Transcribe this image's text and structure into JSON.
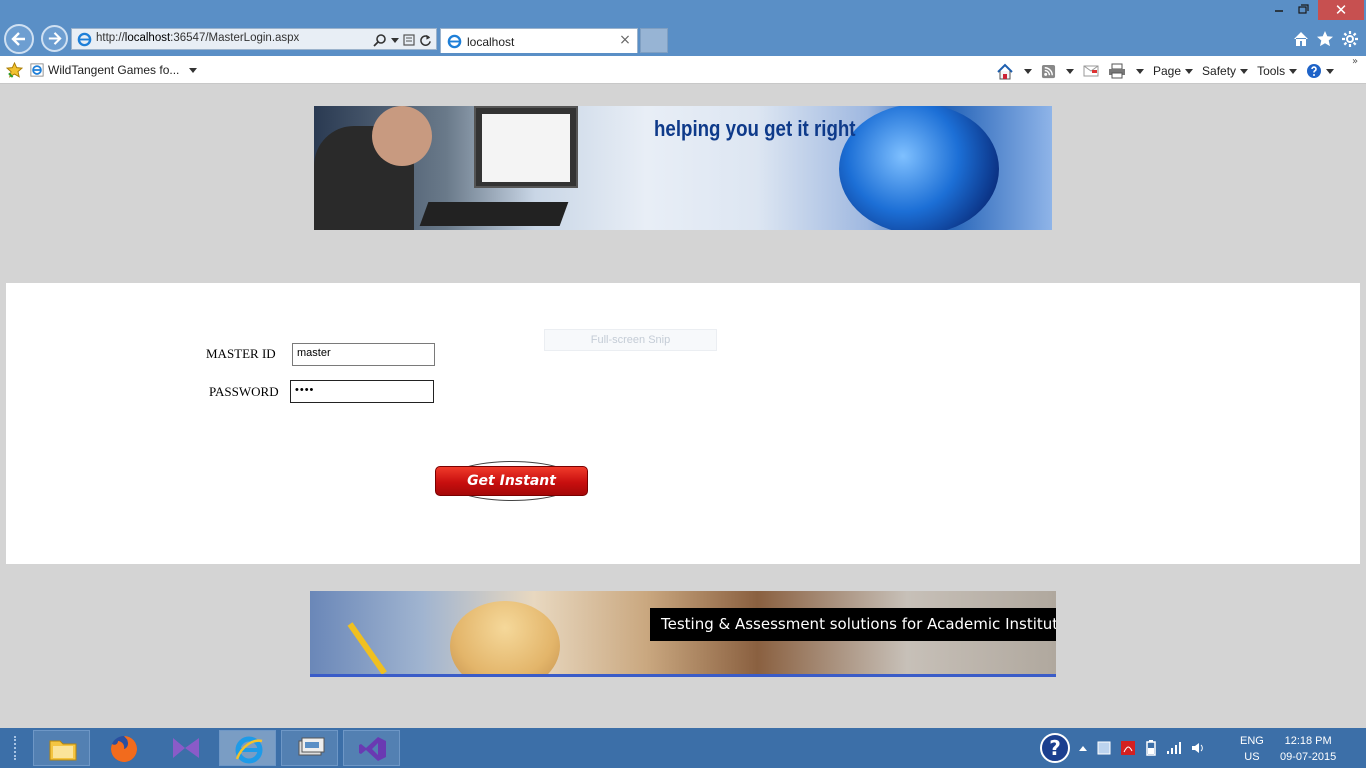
{
  "browser": {
    "address": {
      "scheme": "http://",
      "host": "localhost",
      "rest": ":36547/MasterLogin.aspx"
    },
    "tab_title": "localhost",
    "tab_close": "×",
    "win_close": "✕"
  },
  "commandbar": {
    "favorite_item": "WildTangent Games fo...",
    "page_label": "Page",
    "safety_label": "Safety",
    "tools_label": "Tools",
    "more": "»"
  },
  "page": {
    "tagline": "helping you get it right",
    "master_id_label": "MASTER ID",
    "master_id_value": "master",
    "password_label": "PASSWORD",
    "password_value": "••••",
    "snip_text": "Full-screen Snip",
    "submit_label": "Get Instant Access!",
    "bottom_caption": "Testing & Assessment solutions for Academic Institutes"
  },
  "taskbar": {
    "apps": [
      "file-explorer",
      "firefox",
      "visual-studio-blend",
      "internet-explorer",
      "remote-desktop",
      "visual-studio"
    ],
    "active_app": "internet-explorer",
    "lang_line1": "ENG",
    "lang_line2": "US",
    "time": "12:18 PM",
    "date": "09-07-2015"
  },
  "colors": {
    "titlebar": "#5a8fc6",
    "taskbar": "#3c6fa8",
    "page_bg": "#d4d4d4",
    "button_red": "#c80f0f"
  }
}
